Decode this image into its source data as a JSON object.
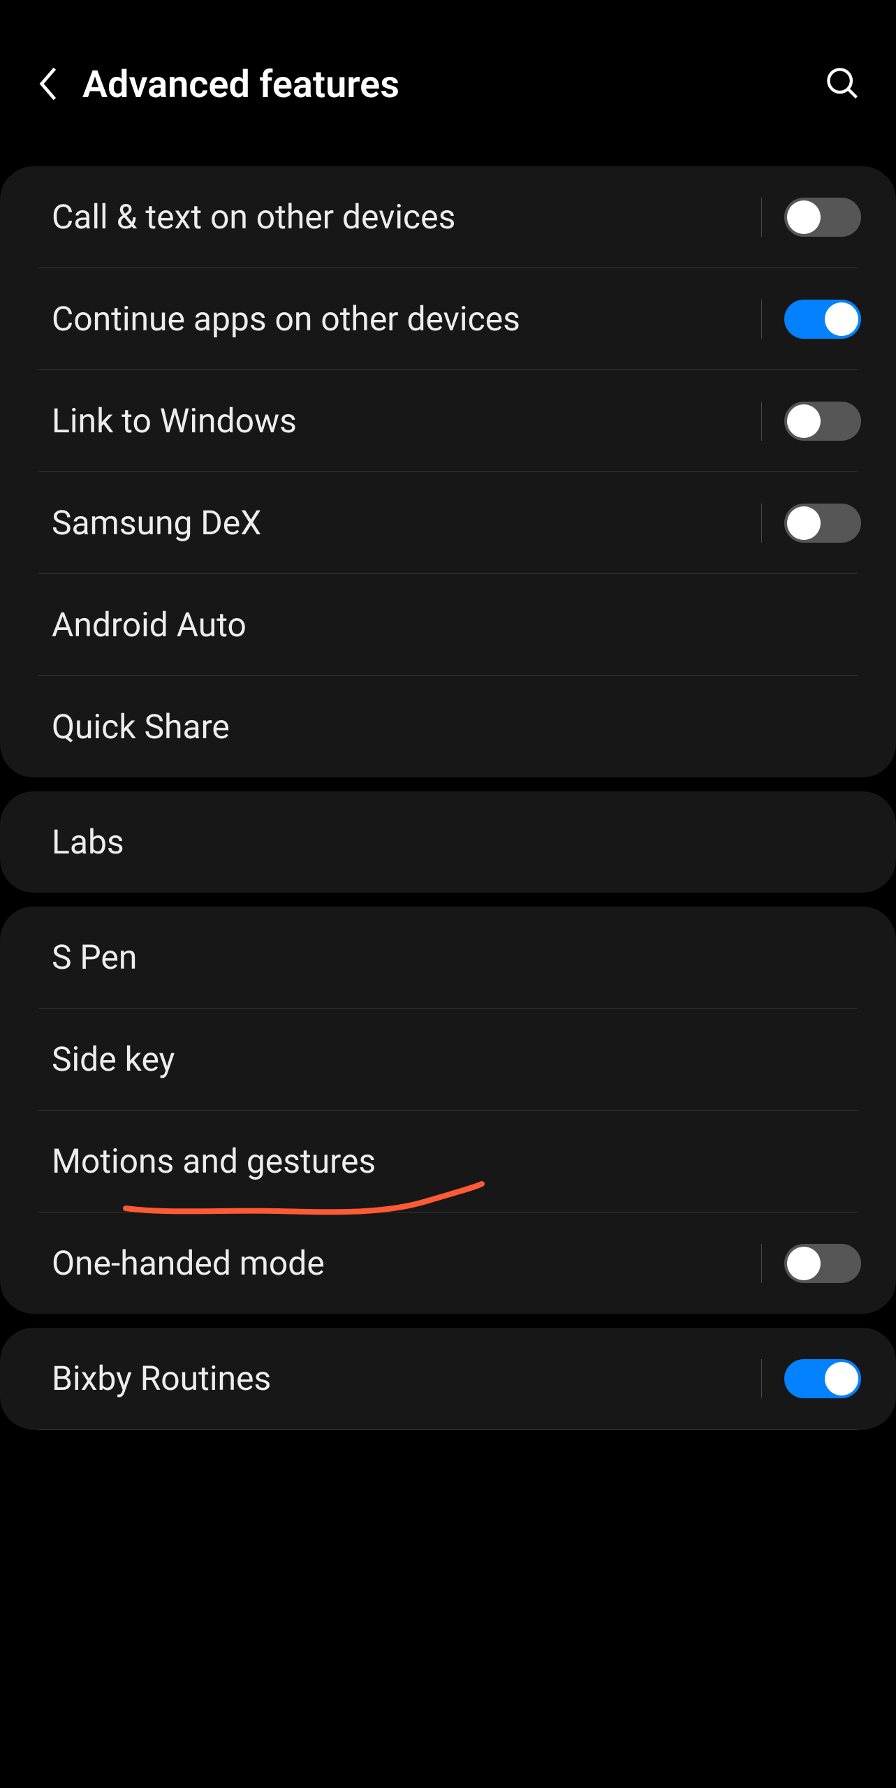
{
  "header": {
    "title": "Advanced features"
  },
  "section1": {
    "items": [
      {
        "label": "Call & text on other devices",
        "toggle": false,
        "has_toggle": true
      },
      {
        "label": "Continue apps on other devices",
        "toggle": true,
        "has_toggle": true
      },
      {
        "label": "Link to Windows",
        "toggle": false,
        "has_toggle": true
      },
      {
        "label": "Samsung DeX",
        "toggle": false,
        "has_toggle": true
      },
      {
        "label": "Android Auto",
        "has_toggle": false
      },
      {
        "label": "Quick Share",
        "has_toggle": false
      }
    ]
  },
  "section2": {
    "items": [
      {
        "label": "Labs",
        "has_toggle": false
      }
    ]
  },
  "section3": {
    "items": [
      {
        "label": "S Pen",
        "has_toggle": false
      },
      {
        "label": "Side key",
        "has_toggle": false
      },
      {
        "label": "Motions and gestures",
        "has_toggle": false
      },
      {
        "label": "One-handed mode",
        "toggle": false,
        "has_toggle": true
      }
    ]
  },
  "section4": {
    "items": [
      {
        "label": "Bixby Routines",
        "toggle": true,
        "has_toggle": true
      }
    ]
  }
}
